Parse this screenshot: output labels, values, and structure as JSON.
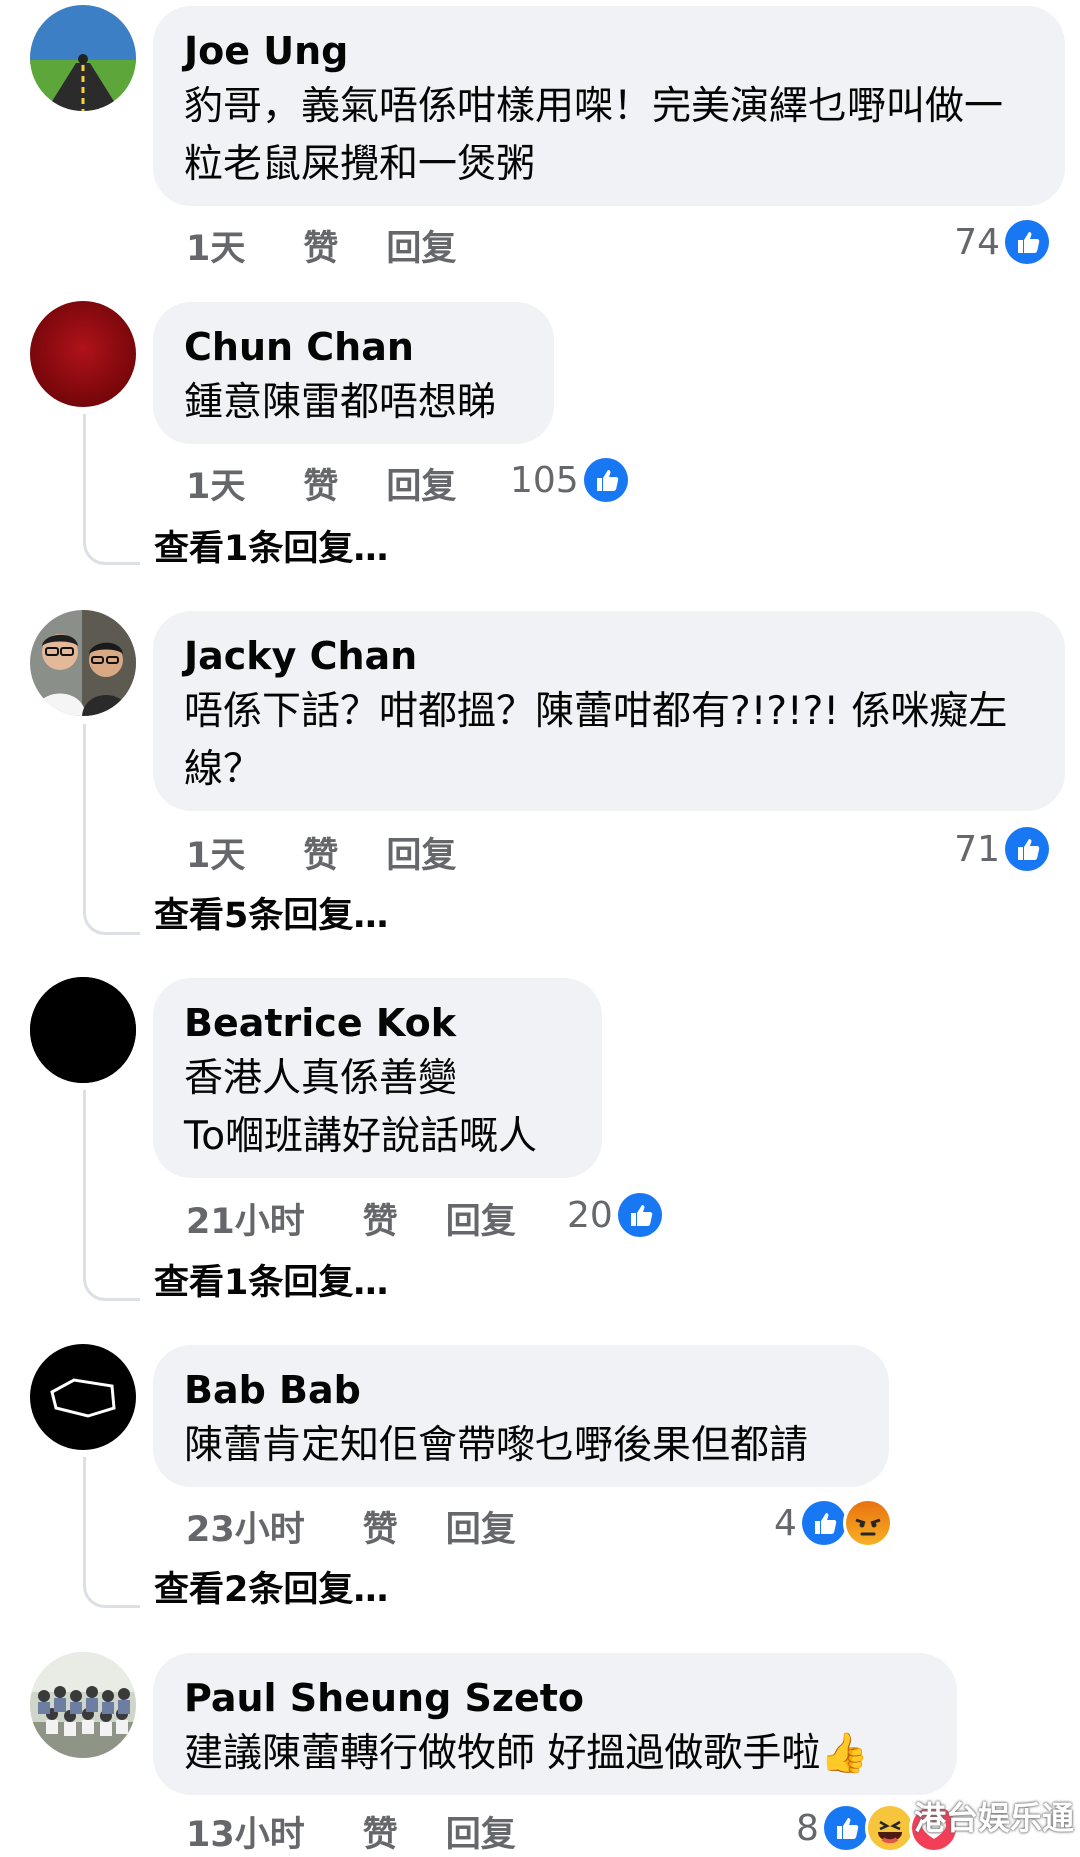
{
  "comments": [
    {
      "author": "Joe Ung",
      "text": "豹哥，義氣唔係咁樣用㗎！完美演繹乜嘢叫做一粒老鼠屎攪和一煲粥",
      "age": "1天",
      "like_label": "赞",
      "reply_label": "回复",
      "reaction_count": "74",
      "reactions": [
        "like"
      ],
      "avatar": "road-landscape-avatar"
    },
    {
      "author": "Chun Chan",
      "text": "鍾意陳雷都唔想睇",
      "age": "1天",
      "like_label": "赞",
      "reply_label": "回复",
      "reaction_count": "105",
      "reactions": [
        "like"
      ],
      "avatar": "red-circle-avatar",
      "more_replies": "查看1条回复…"
    },
    {
      "author": "Jacky Chan",
      "text": "唔係下話？咁都搵？陳蕾咁都有?!?!?! 係咪癡左線？",
      "age": "1天",
      "like_label": "赞",
      "reply_label": "回复",
      "reaction_count": "71",
      "reactions": [
        "like"
      ],
      "avatar": "two-people-photo-avatar",
      "more_replies": "查看5条回复…"
    },
    {
      "author": "Beatrice Kok",
      "text": "香港人真係善變\nTo嗰班講好說話嘅人",
      "age": "21小时",
      "like_label": "赞",
      "reply_label": "回复",
      "reaction_count": "20",
      "reactions": [
        "like"
      ],
      "avatar": "black-circle-avatar",
      "more_replies": "查看1条回复…"
    },
    {
      "author": "Bab Bab",
      "text": "陳蕾肯定知佢會帶嚟乜嘢後果但都請",
      "age": "23小时",
      "like_label": "赞",
      "reply_label": "回复",
      "reaction_count": "4",
      "reactions": [
        "like",
        "angry"
      ],
      "avatar": "black-hexagon-avatar",
      "more_replies": "查看2条回复…"
    },
    {
      "author": "Paul Sheung Szeto",
      "text": "建議陳蕾轉行做牧師 好搵過做歌手啦👍",
      "age": "13小时",
      "like_label": "赞",
      "reply_label": "回复",
      "reaction_count": "8",
      "reactions": [
        "like",
        "haha",
        "love"
      ],
      "avatar": "group-photo-avatar"
    }
  ],
  "watermark": "港台娱乐通",
  "colors": {
    "like_blue": "#1877f2",
    "bubble_bg": "#f0f2f5",
    "meta_gray": "#65676b",
    "angry_orange": "#e9710f"
  }
}
